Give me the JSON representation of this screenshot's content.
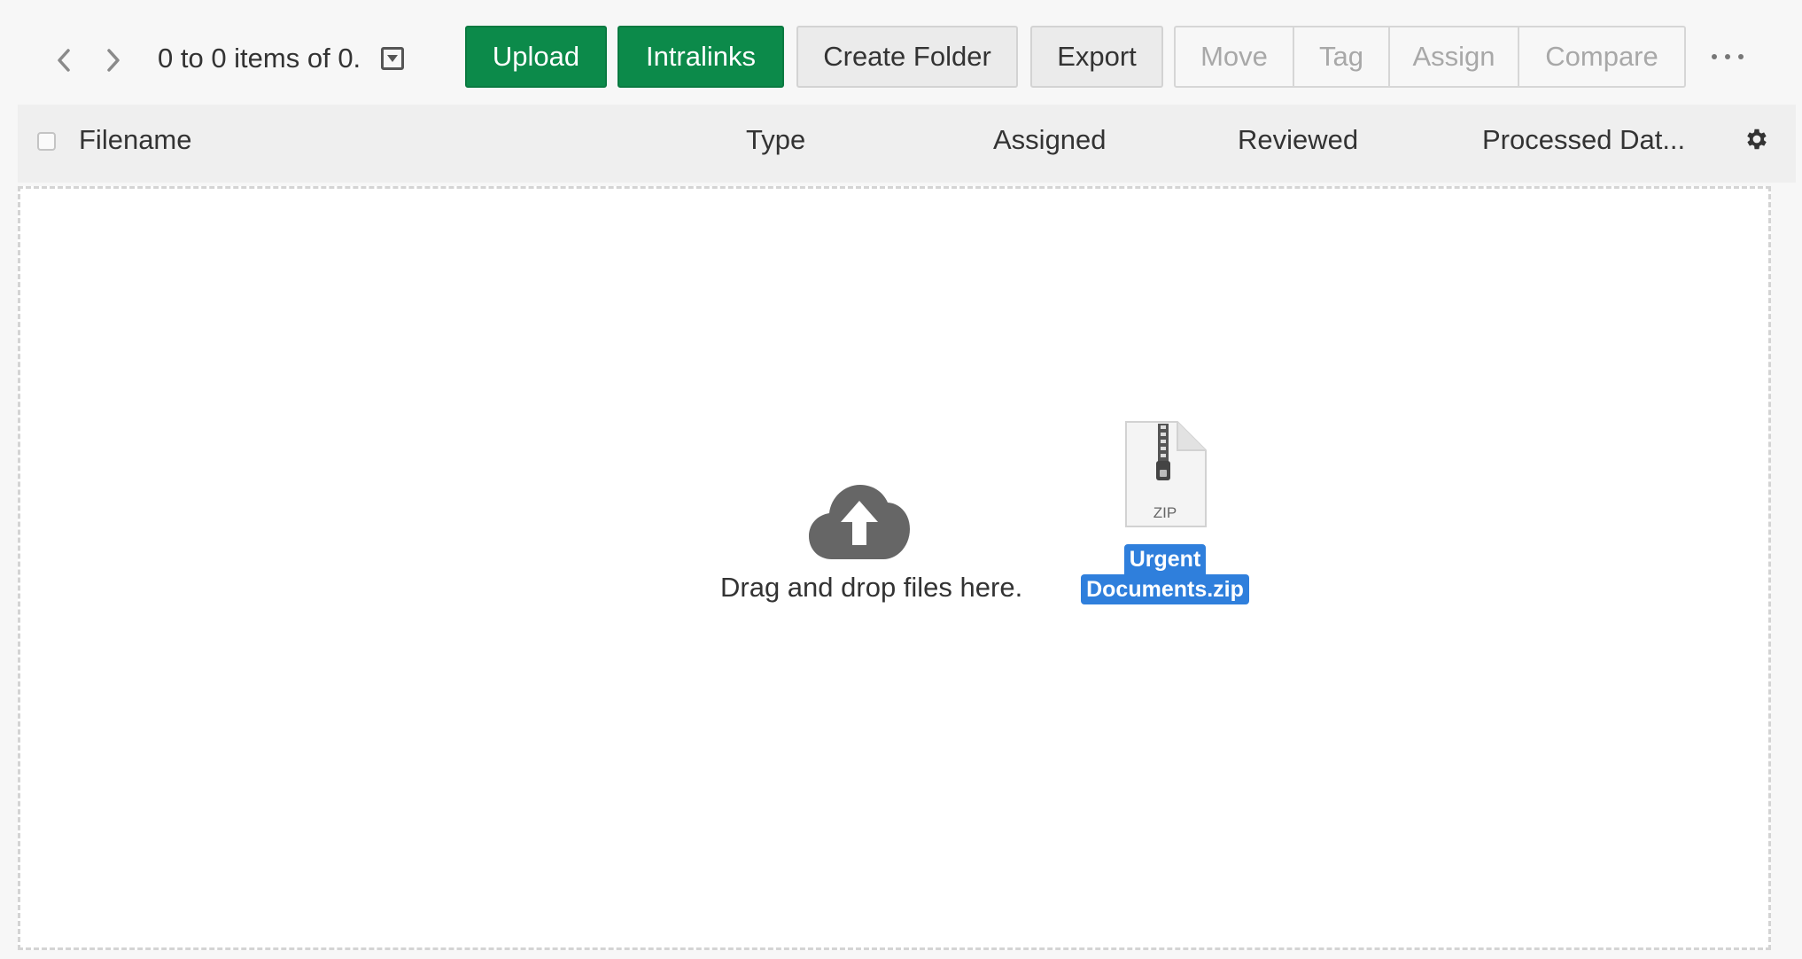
{
  "toolbar": {
    "pager_text": "0 to 0 items of 0.",
    "upload_label": "Upload",
    "intralinks_label": "Intralinks",
    "create_folder_label": "Create Folder",
    "export_label": "Export",
    "move_label": "Move",
    "tag_label": "Tag",
    "assign_label": "Assign",
    "compare_label": "Compare"
  },
  "table": {
    "columns": [
      "Filename",
      "Type",
      "Assigned",
      "Reviewed",
      "Processed Dat..."
    ]
  },
  "dropzone": {
    "text": "Drag and drop files here."
  },
  "dragged_file": {
    "type_label": "ZIP",
    "name_line1": "Urgent",
    "name_line2": "Documents.zip"
  },
  "icons": {
    "prev": "chevron-left-icon",
    "next": "chevron-right-icon",
    "dropdown": "caret-down-icon",
    "more": "ellipsis-icon",
    "settings": "gear-icon",
    "upload": "cloud-upload-icon",
    "file": "zip-file-icon"
  },
  "colors": {
    "primary_green": "#0c8a4a",
    "selection_blue": "#2f7fdc",
    "disabled_text": "#a8a8a8"
  }
}
